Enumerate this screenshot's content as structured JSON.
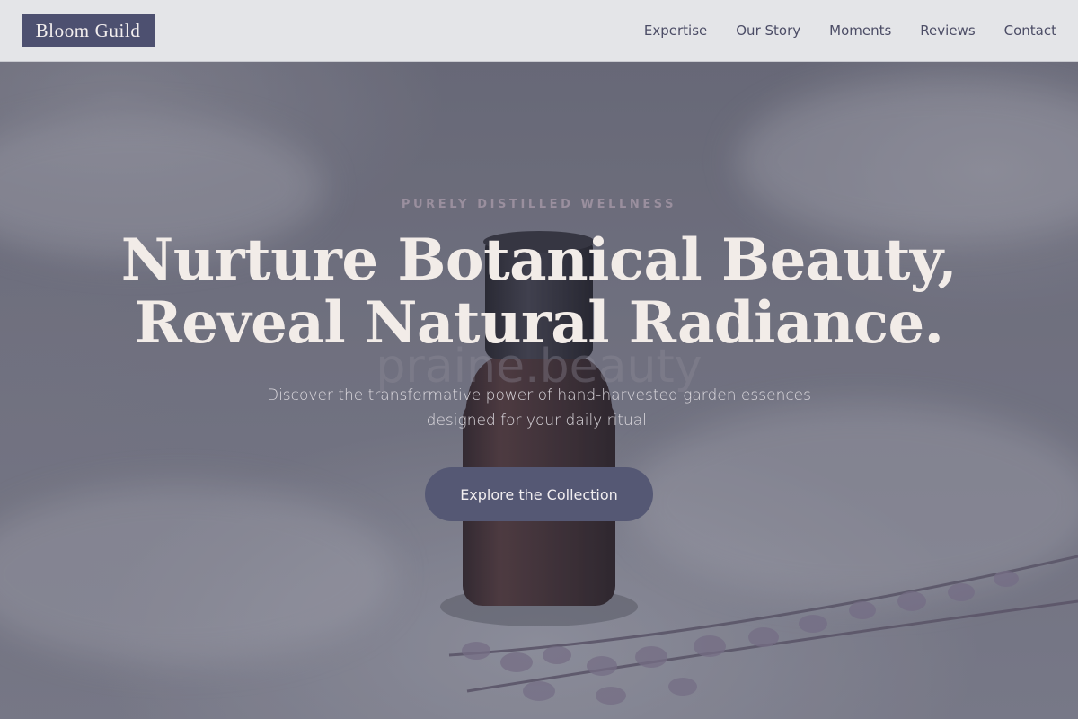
{
  "header": {
    "logo_text": "Bloom Guild",
    "nav": [
      {
        "label": "Expertise"
      },
      {
        "label": "Our Story"
      },
      {
        "label": "Moments"
      },
      {
        "label": "Reviews"
      },
      {
        "label": "Contact"
      }
    ]
  },
  "hero": {
    "eyebrow": "PURELY DISTILLED WELLNESS",
    "headline_line1": "Nurture Botanical Beauty,",
    "headline_line2": "Reveal Natural Radiance.",
    "subtext": "Discover the transformative power of hand-harvested garden essences designed for your daily ritual.",
    "cta_label": "Explore the Collection",
    "bottle_label_text": "praine.beauty"
  },
  "colors": {
    "header_bg": "#e4e5e8",
    "logo_bg": "#4d5070",
    "nav_text": "#4c4d66",
    "eyebrow": "#9a8f9e",
    "headline": "#f2ece8",
    "cta_bg": "#555874"
  }
}
